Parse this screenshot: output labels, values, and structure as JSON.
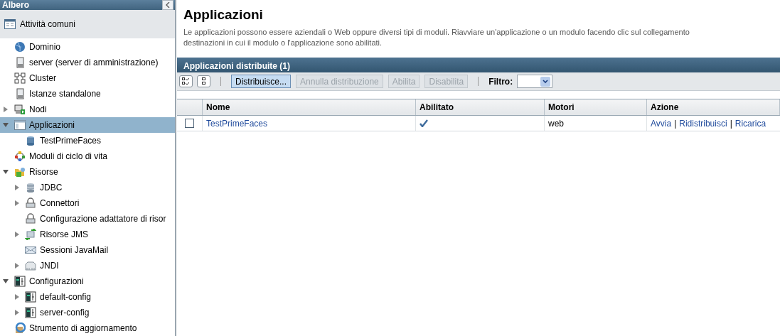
{
  "sidebar": {
    "title": "Albero",
    "common_tasks": "Attività comuni",
    "tree": [
      {
        "label": "Dominio"
      },
      {
        "label": "server (server di amministrazione)"
      },
      {
        "label": "Cluster"
      },
      {
        "label": "Istanze standalone"
      },
      {
        "label": "Nodi",
        "expanded": false
      },
      {
        "label": "Applicazioni",
        "expanded": true,
        "selected": true,
        "children": [
          {
            "label": "TestPrimeFaces"
          }
        ]
      },
      {
        "label": "Moduli di ciclo di vita"
      },
      {
        "label": "Risorse",
        "expanded": true,
        "children": [
          {
            "label": "JDBC",
            "expanded": false
          },
          {
            "label": "Connettori",
            "expanded": false
          },
          {
            "label": "Configurazione adattatore di risor"
          },
          {
            "label": "Risorse JMS",
            "expanded": false
          },
          {
            "label": "Sessioni JavaMail"
          },
          {
            "label": "JNDI",
            "expanded": false
          }
        ]
      },
      {
        "label": "Configurazioni",
        "expanded": true,
        "children": [
          {
            "label": "default-config",
            "expanded": false
          },
          {
            "label": "server-config",
            "expanded": false
          }
        ]
      },
      {
        "label": "Strumento di aggiornamento"
      }
    ]
  },
  "page": {
    "title": "Applicazioni",
    "description": [
      "Le applicazioni possono essere aziendali o Web oppure diversi tipi di moduli. Riavviare un'applicazione o un modulo facendo clic sul collegamento",
      "destinazioni in cui il modulo o l'applicazione sono abilitati."
    ]
  },
  "table": {
    "title": "Applicazioni distribuite (1)",
    "buttons": [
      {
        "label": "Distribuisce...",
        "disabled": false
      },
      {
        "label": "Annulla distribuzione",
        "disabled": true
      },
      {
        "label": "Abilita",
        "disabled": true
      },
      {
        "label": "Disabilita",
        "disabled": true
      }
    ],
    "filter": {
      "label": "Filtro:"
    },
    "columns": [
      "Nome",
      "Abilitato",
      "Motori",
      "Azione"
    ],
    "rows": [
      {
        "checked": false,
        "name": "TestPrimeFaces",
        "enabled": true,
        "engines": "web",
        "actions": [
          "Avvia",
          "Ridistribuisci",
          "Ricarica"
        ],
        "action_separator": "|"
      }
    ]
  }
}
